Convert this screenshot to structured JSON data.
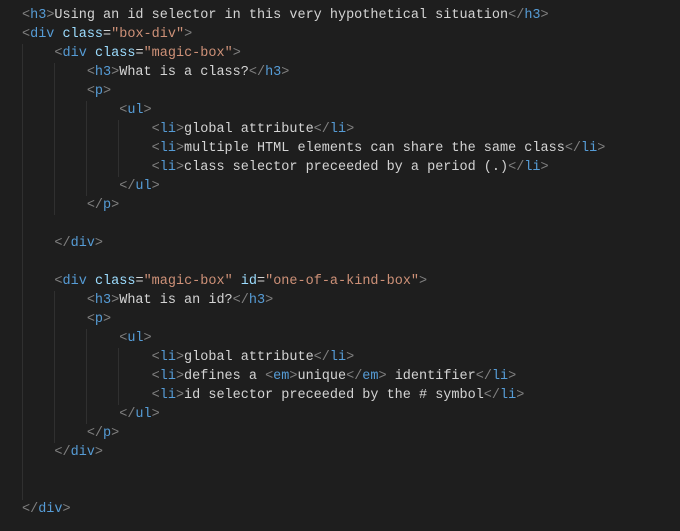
{
  "lines": [
    {
      "indent": 0,
      "parts": [
        {
          "c": "bracket",
          "t": "<"
        },
        {
          "c": "tagname",
          "t": "h3"
        },
        {
          "c": "bracket",
          "t": ">"
        },
        {
          "c": "text",
          "t": "Using an id selector in this very hypothetical situation"
        },
        {
          "c": "bracket",
          "t": "</"
        },
        {
          "c": "tagname",
          "t": "h3"
        },
        {
          "c": "bracket",
          "t": ">"
        }
      ]
    },
    {
      "indent": 0,
      "parts": [
        {
          "c": "bracket",
          "t": "<"
        },
        {
          "c": "tagname",
          "t": "div"
        },
        {
          "c": "text",
          "t": " "
        },
        {
          "c": "attrname",
          "t": "class"
        },
        {
          "c": "punct",
          "t": "="
        },
        {
          "c": "attrval",
          "t": "\"box-div\""
        },
        {
          "c": "bracket",
          "t": ">"
        }
      ]
    },
    {
      "indent": 1,
      "parts": [
        {
          "c": "bracket",
          "t": "<"
        },
        {
          "c": "tagname",
          "t": "div"
        },
        {
          "c": "text",
          "t": " "
        },
        {
          "c": "attrname",
          "t": "class"
        },
        {
          "c": "punct",
          "t": "="
        },
        {
          "c": "attrval",
          "t": "\"magic-box\""
        },
        {
          "c": "bracket",
          "t": ">"
        }
      ]
    },
    {
      "indent": 2,
      "parts": [
        {
          "c": "bracket",
          "t": "<"
        },
        {
          "c": "tagname",
          "t": "h3"
        },
        {
          "c": "bracket",
          "t": ">"
        },
        {
          "c": "text",
          "t": "What is a class?"
        },
        {
          "c": "bracket",
          "t": "</"
        },
        {
          "c": "tagname",
          "t": "h3"
        },
        {
          "c": "bracket",
          "t": ">"
        }
      ]
    },
    {
      "indent": 2,
      "parts": [
        {
          "c": "bracket",
          "t": "<"
        },
        {
          "c": "tagname",
          "t": "p"
        },
        {
          "c": "bracket",
          "t": ">"
        }
      ]
    },
    {
      "indent": 3,
      "parts": [
        {
          "c": "bracket",
          "t": "<"
        },
        {
          "c": "tagname",
          "t": "ul"
        },
        {
          "c": "bracket",
          "t": ">"
        }
      ]
    },
    {
      "indent": 4,
      "parts": [
        {
          "c": "bracket",
          "t": "<"
        },
        {
          "c": "tagname",
          "t": "li"
        },
        {
          "c": "bracket",
          "t": ">"
        },
        {
          "c": "text",
          "t": "global attribute"
        },
        {
          "c": "bracket",
          "t": "</"
        },
        {
          "c": "tagname",
          "t": "li"
        },
        {
          "c": "bracket",
          "t": ">"
        }
      ]
    },
    {
      "indent": 4,
      "parts": [
        {
          "c": "bracket",
          "t": "<"
        },
        {
          "c": "tagname",
          "t": "li"
        },
        {
          "c": "bracket",
          "t": ">"
        },
        {
          "c": "text",
          "t": "multiple HTML elements can share the same class"
        },
        {
          "c": "bracket",
          "t": "</"
        },
        {
          "c": "tagname",
          "t": "li"
        },
        {
          "c": "bracket",
          "t": ">"
        }
      ]
    },
    {
      "indent": 4,
      "parts": [
        {
          "c": "bracket",
          "t": "<"
        },
        {
          "c": "tagname",
          "t": "li"
        },
        {
          "c": "bracket",
          "t": ">"
        },
        {
          "c": "text",
          "t": "class selector preceeded by a period (.)"
        },
        {
          "c": "bracket",
          "t": "</"
        },
        {
          "c": "tagname",
          "t": "li"
        },
        {
          "c": "bracket",
          "t": ">"
        }
      ]
    },
    {
      "indent": 3,
      "parts": [
        {
          "c": "bracket",
          "t": "</"
        },
        {
          "c": "tagname",
          "t": "ul"
        },
        {
          "c": "bracket",
          "t": ">"
        }
      ]
    },
    {
      "indent": 2,
      "parts": [
        {
          "c": "bracket",
          "t": "</"
        },
        {
          "c": "tagname",
          "t": "p"
        },
        {
          "c": "bracket",
          "t": ">"
        }
      ]
    },
    {
      "indent": 0,
      "parts": []
    },
    {
      "indent": 1,
      "parts": [
        {
          "c": "bracket",
          "t": "</"
        },
        {
          "c": "tagname",
          "t": "div"
        },
        {
          "c": "bracket",
          "t": ">"
        }
      ]
    },
    {
      "indent": 0,
      "parts": []
    },
    {
      "indent": 1,
      "parts": [
        {
          "c": "bracket",
          "t": "<"
        },
        {
          "c": "tagname",
          "t": "div"
        },
        {
          "c": "text",
          "t": " "
        },
        {
          "c": "attrname",
          "t": "class"
        },
        {
          "c": "punct",
          "t": "="
        },
        {
          "c": "attrval",
          "t": "\"magic-box\""
        },
        {
          "c": "text",
          "t": " "
        },
        {
          "c": "attrname",
          "t": "id"
        },
        {
          "c": "punct",
          "t": "="
        },
        {
          "c": "attrval",
          "t": "\"one-of-a-kind-box\""
        },
        {
          "c": "bracket",
          "t": ">"
        }
      ]
    },
    {
      "indent": 2,
      "parts": [
        {
          "c": "bracket",
          "t": "<"
        },
        {
          "c": "tagname",
          "t": "h3"
        },
        {
          "c": "bracket",
          "t": ">"
        },
        {
          "c": "text",
          "t": "What is an id?"
        },
        {
          "c": "bracket",
          "t": "</"
        },
        {
          "c": "tagname",
          "t": "h3"
        },
        {
          "c": "bracket",
          "t": ">"
        }
      ]
    },
    {
      "indent": 2,
      "parts": [
        {
          "c": "bracket",
          "t": "<"
        },
        {
          "c": "tagname",
          "t": "p"
        },
        {
          "c": "bracket",
          "t": ">"
        }
      ]
    },
    {
      "indent": 3,
      "parts": [
        {
          "c": "bracket",
          "t": "<"
        },
        {
          "c": "tagname",
          "t": "ul"
        },
        {
          "c": "bracket",
          "t": ">"
        }
      ]
    },
    {
      "indent": 4,
      "parts": [
        {
          "c": "bracket",
          "t": "<"
        },
        {
          "c": "tagname",
          "t": "li"
        },
        {
          "c": "bracket",
          "t": ">"
        },
        {
          "c": "text",
          "t": "global attribute"
        },
        {
          "c": "bracket",
          "t": "</"
        },
        {
          "c": "tagname",
          "t": "li"
        },
        {
          "c": "bracket",
          "t": ">"
        }
      ]
    },
    {
      "indent": 4,
      "parts": [
        {
          "c": "bracket",
          "t": "<"
        },
        {
          "c": "tagname",
          "t": "li"
        },
        {
          "c": "bracket",
          "t": ">"
        },
        {
          "c": "text",
          "t": "defines a "
        },
        {
          "c": "bracket",
          "t": "<"
        },
        {
          "c": "tagname",
          "t": "em"
        },
        {
          "c": "bracket",
          "t": ">"
        },
        {
          "c": "text",
          "t": "unique"
        },
        {
          "c": "bracket",
          "t": "</"
        },
        {
          "c": "tagname",
          "t": "em"
        },
        {
          "c": "bracket",
          "t": ">"
        },
        {
          "c": "text",
          "t": " identifier"
        },
        {
          "c": "bracket",
          "t": "</"
        },
        {
          "c": "tagname",
          "t": "li"
        },
        {
          "c": "bracket",
          "t": ">"
        }
      ]
    },
    {
      "indent": 4,
      "parts": [
        {
          "c": "bracket",
          "t": "<"
        },
        {
          "c": "tagname",
          "t": "li"
        },
        {
          "c": "bracket",
          "t": ">"
        },
        {
          "c": "text",
          "t": "id selector preceeded by the # symbol"
        },
        {
          "c": "bracket",
          "t": "</"
        },
        {
          "c": "tagname",
          "t": "li"
        },
        {
          "c": "bracket",
          "t": ">"
        }
      ]
    },
    {
      "indent": 3,
      "parts": [
        {
          "c": "bracket",
          "t": "</"
        },
        {
          "c": "tagname",
          "t": "ul"
        },
        {
          "c": "bracket",
          "t": ">"
        }
      ]
    },
    {
      "indent": 2,
      "parts": [
        {
          "c": "bracket",
          "t": "</"
        },
        {
          "c": "tagname",
          "t": "p"
        },
        {
          "c": "bracket",
          "t": ">"
        }
      ]
    },
    {
      "indent": 1,
      "parts": [
        {
          "c": "bracket",
          "t": "</"
        },
        {
          "c": "tagname",
          "t": "div"
        },
        {
          "c": "bracket",
          "t": ">"
        }
      ]
    },
    {
      "indent": 0,
      "parts": []
    },
    {
      "indent": 0,
      "parts": []
    },
    {
      "indent": 0,
      "parts": [
        {
          "c": "bracket",
          "t": "</"
        },
        {
          "c": "tagname",
          "t": "div"
        },
        {
          "c": "bracket",
          "t": ">"
        }
      ]
    }
  ],
  "guides_per_line": [
    [],
    [],
    [
      1
    ],
    [
      1,
      2
    ],
    [
      1,
      2
    ],
    [
      1,
      2,
      3
    ],
    [
      1,
      2,
      3,
      4
    ],
    [
      1,
      2,
      3,
      4
    ],
    [
      1,
      2,
      3,
      4
    ],
    [
      1,
      2,
      3
    ],
    [
      1,
      2
    ],
    [
      1
    ],
    [
      1
    ],
    [
      1
    ],
    [
      1
    ],
    [
      1,
      2
    ],
    [
      1,
      2
    ],
    [
      1,
      2,
      3
    ],
    [
      1,
      2,
      3,
      4
    ],
    [
      1,
      2,
      3,
      4
    ],
    [
      1,
      2,
      3,
      4
    ],
    [
      1,
      2,
      3
    ],
    [
      1,
      2
    ],
    [
      1
    ],
    [
      1
    ],
    [
      1
    ],
    []
  ]
}
